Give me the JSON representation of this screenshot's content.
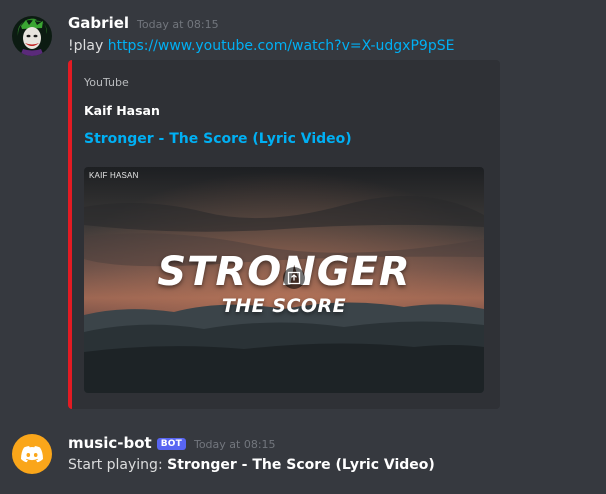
{
  "messages": [
    {
      "username": "Gabriel",
      "timestamp": "Today at 08:15",
      "text_prefix": "!play ",
      "link": "https://www.youtube.com/watch?v=X-udgxP9pSE",
      "avatar_icon": "joker-avatar-icon",
      "embed": {
        "provider": "YouTube",
        "author": "Kaif Hasan",
        "title": "Stronger - The Score (Lyric Video)",
        "accent_color": "#e31b23",
        "video": {
          "channel_watermark": "KAIF HASAN",
          "title_main": "STRONGER",
          "title_sub": "THE SCORE",
          "play_icon": "play-icon"
        }
      }
    },
    {
      "username": "music-bot",
      "bot_tag": "BOT",
      "timestamp": "Today at 08:15",
      "text_prefix": "Start playing: ",
      "text_bold": "Stronger - The Score (Lyric Video)",
      "avatar_icon": "discord-logo-icon",
      "avatar_color": "#faa61a"
    }
  ],
  "colors": {
    "background": "#36393f",
    "link": "#00b0f4",
    "bot_tag": "#5865f2",
    "embed_bg": "#2f3136"
  }
}
